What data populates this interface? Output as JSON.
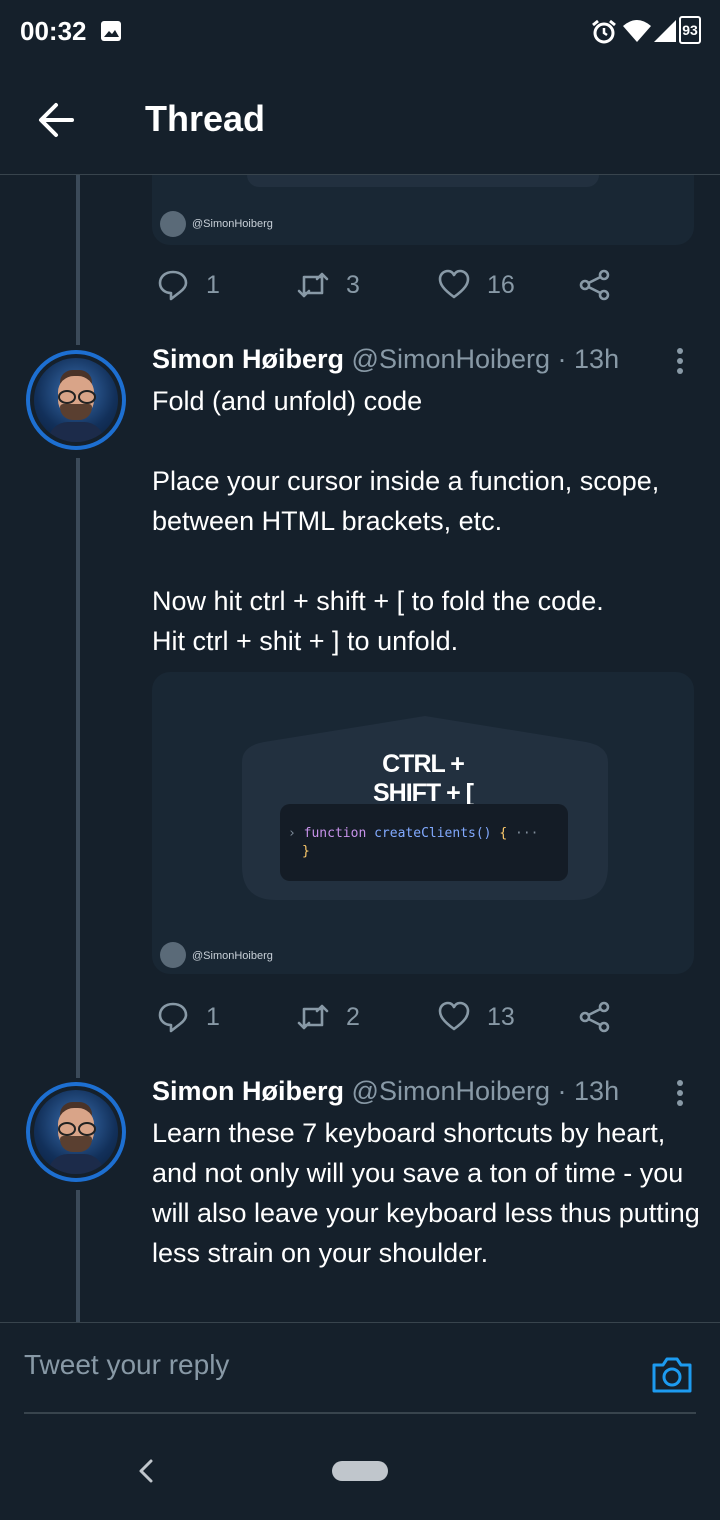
{
  "status_bar": {
    "time": "00:32",
    "battery": "93"
  },
  "header": {
    "title": "Thread"
  },
  "colors": {
    "background": "#15202b",
    "accent": "#1d9bf0",
    "secondary_text": "#8899a6",
    "divider": "#38444d"
  },
  "previous_tweet": {
    "watermark": "@SimonHoiberg",
    "actions": {
      "replies": "1",
      "retweets": "3",
      "likes": "16"
    }
  },
  "tweets": [
    {
      "name": "Simon Høiberg",
      "handle": "@SimonHoiberg",
      "time": "· 13h",
      "text": "Fold (and unfold) code\n\nPlace your cursor inside a function, scope, between HTML brackets, etc.\n\nNow hit ctrl + shift + [ to fold the code.\nHit ctrl + shit + ] to unfold.",
      "media": {
        "shortcut": "CTRL + SHIFT + [",
        "code_keyword": "function",
        "code_function": "createClients()",
        "code_brace": "{",
        "code_ellipsis": "···",
        "code_close": "}",
        "watermark": "@SimonHoiberg"
      },
      "actions": {
        "replies": "1",
        "retweets": "2",
        "likes": "13"
      }
    },
    {
      "name": "Simon Høiberg",
      "handle": "@SimonHoiberg",
      "time": "· 13h",
      "text": "Learn these 7 keyboard shortcuts by heart, and not only will you save a ton of time - you will also leave your keyboard less thus putting less strain on your shoulder."
    }
  ],
  "reply": {
    "placeholder": "Tweet your reply"
  },
  "icons": {
    "back": "arrow-left-icon",
    "reply": "speech-bubble-icon",
    "retweet": "retweet-icon",
    "like": "heart-icon",
    "share": "share-icon",
    "more": "kebab-icon",
    "camera": "camera-icon"
  }
}
